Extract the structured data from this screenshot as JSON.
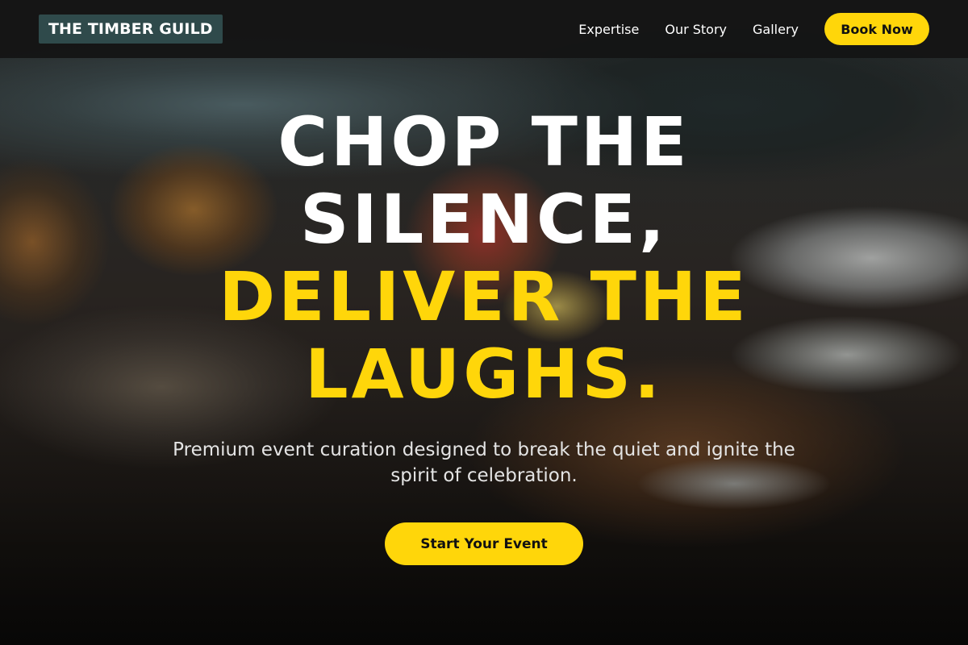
{
  "navbar": {
    "logo": "THE TIMBER GUILD",
    "links": [
      "Expertise",
      "Our Story",
      "Gallery"
    ],
    "cta": "Book Now"
  },
  "hero": {
    "headline_white": [
      "CHOP THE",
      "SILENCE,"
    ],
    "headline_yellow": [
      "DELIVER THE",
      "LAUGHS."
    ],
    "subtitle": "Premium event curation designed to break the quiet and ignite the spirit of celebration.",
    "cta": "Start Your Event",
    "background_image": "blurred banquet table with floral centerpiece and place settings"
  },
  "colors": {
    "accent": "#ffd60a",
    "navbar_bg": "#141414",
    "logo_bg": "#2f4a4b",
    "text_light": "#ffffff"
  }
}
